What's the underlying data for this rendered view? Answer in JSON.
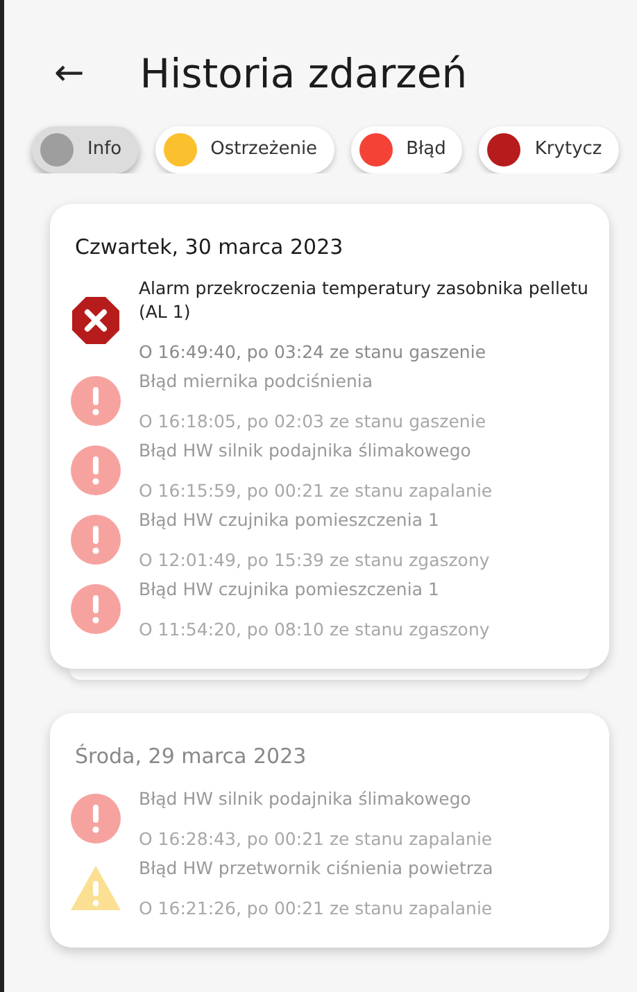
{
  "header": {
    "back_icon": "←",
    "title": "Historia zdarzeń"
  },
  "filters": [
    {
      "label": "Info",
      "color": "#9e9e9e",
      "selected": true
    },
    {
      "label": "Ostrzeżenie",
      "color": "#fbc02d",
      "selected": false
    },
    {
      "label": "Błąd",
      "color": "#f44336",
      "selected": false
    },
    {
      "label": "Krytycz",
      "color": "#b71c1c",
      "selected": false
    }
  ],
  "days": [
    {
      "date": "Czwartek, 30 marca 2023",
      "highlighted": true,
      "stacked": true,
      "events": [
        {
          "kind": "critical",
          "active": true,
          "title": "Alarm przekroczenia temperatury zasobnika pelletu (AL 1)",
          "detail": "O 16:49:40, po 03:24 ze stanu gaszenie"
        },
        {
          "kind": "error",
          "active": false,
          "title": "Błąd miernika podciśnienia",
          "detail": "O 16:18:05, po 02:03 ze stanu gaszenie"
        },
        {
          "kind": "error",
          "active": false,
          "title": "Błąd HW silnik podajnika ślimakowego",
          "detail": "O 16:15:59, po 00:21 ze stanu zapalanie"
        },
        {
          "kind": "error",
          "active": false,
          "title": "Błąd HW czujnika pomieszczenia 1",
          "detail": "O 12:01:49, po 15:39 ze stanu zgaszony"
        },
        {
          "kind": "error",
          "active": false,
          "title": "Błąd HW czujnika pomieszczenia 1",
          "detail": "O 11:54:20, po 08:10 ze stanu zgaszony"
        }
      ]
    },
    {
      "date": "Środa, 29 marca 2023",
      "highlighted": false,
      "stacked": false,
      "events": [
        {
          "kind": "error",
          "active": false,
          "title": "Błąd HW silnik podajnika ślimakowego",
          "detail": "O 16:28:43, po 00:21 ze stanu zapalanie"
        },
        {
          "kind": "warning",
          "active": false,
          "title": "Błąd HW przetwornik ciśnienia powietrza",
          "detail": "O 16:21:26, po 00:21 ze stanu zapalanie"
        }
      ]
    }
  ]
}
